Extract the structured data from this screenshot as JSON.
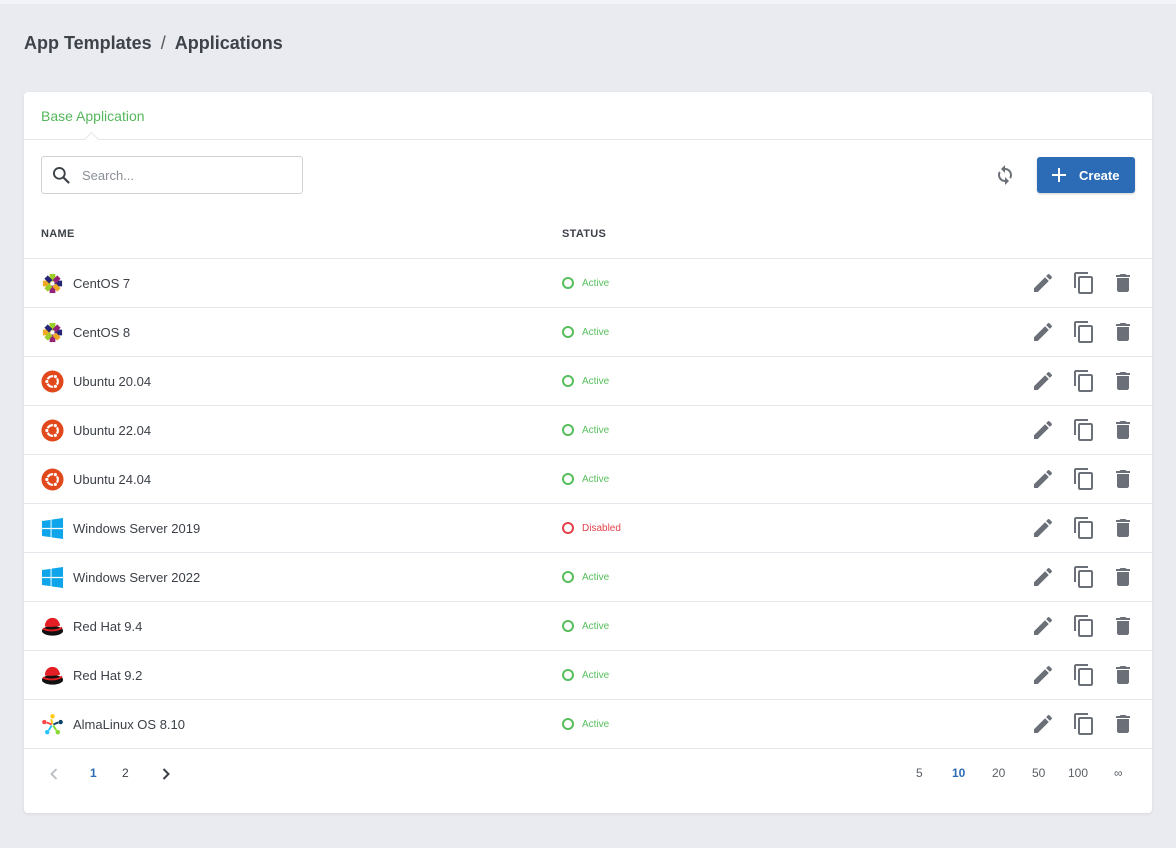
{
  "breadcrumb": {
    "parent": "App Templates",
    "separator": "/",
    "current": "Applications"
  },
  "tab": {
    "label": "Base Application",
    "color": "#55b85c"
  },
  "search": {
    "placeholder": "Search...",
    "value": ""
  },
  "toolbar": {
    "create_label": "Create",
    "accent": "#2c6cb6"
  },
  "table": {
    "headers": {
      "name": "NAME",
      "status": "STATUS"
    },
    "rows": [
      {
        "name": "CentOS 7",
        "icon": "centos-logo-icon",
        "status": "Active"
      },
      {
        "name": "CentOS 8",
        "icon": "centos-logo-icon",
        "status": "Active"
      },
      {
        "name": "Ubuntu 20.04",
        "icon": "ubuntu-logo-icon",
        "status": "Active"
      },
      {
        "name": "Ubuntu 22.04",
        "icon": "ubuntu-logo-icon",
        "status": "Active"
      },
      {
        "name": "Ubuntu 24.04",
        "icon": "ubuntu-logo-icon",
        "status": "Active"
      },
      {
        "name": "Windows Server 2019",
        "icon": "windows-logo-icon",
        "status": "Disabled"
      },
      {
        "name": "Windows Server 2022",
        "icon": "windows-logo-icon",
        "status": "Active"
      },
      {
        "name": "Red Hat 9.4",
        "icon": "redhat-logo-icon",
        "status": "Active"
      },
      {
        "name": "Red Hat 9.2",
        "icon": "redhat-logo-icon",
        "status": "Active"
      },
      {
        "name": "AlmaLinux OS 8.10",
        "icon": "almalinux-logo-icon",
        "status": "Active"
      }
    ]
  },
  "status_colors": {
    "Active": "#56bf5c",
    "Disabled": "#e6424b"
  },
  "pagination": {
    "pages": [
      "1",
      "2"
    ],
    "current_page": "1",
    "page_sizes": [
      "5",
      "10",
      "20",
      "50",
      "100",
      "∞"
    ],
    "current_size": "10"
  }
}
